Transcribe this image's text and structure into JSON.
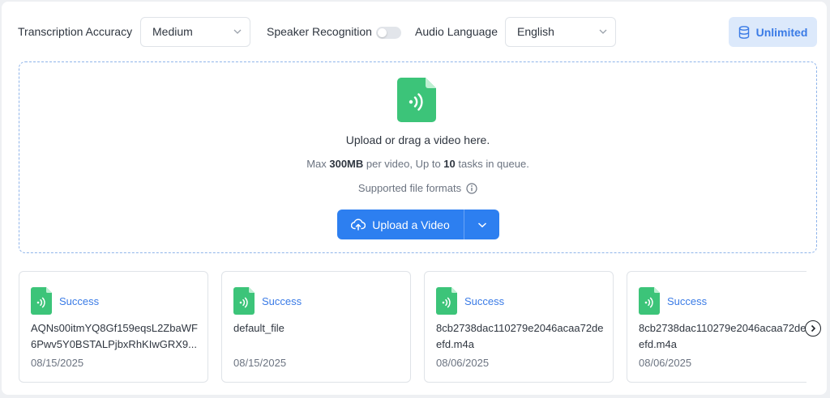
{
  "settings": {
    "accuracy_label": "Transcription Accuracy",
    "accuracy_value": "Medium",
    "speaker_label": "Speaker Recognition",
    "speaker_enabled": false,
    "language_label": "Audio Language",
    "language_value": "English",
    "plan_label": "Unlimited"
  },
  "upload": {
    "title": "Upload or drag a video here.",
    "limit_prefix": "Max ",
    "limit_size": "300MB",
    "limit_mid": " per video, Up to ",
    "limit_count": "10",
    "limit_suffix": " tasks in queue.",
    "formats_label": "Supported file formats",
    "button_label": "Upload a Video"
  },
  "files": [
    {
      "status": "Success",
      "name": "AQNs00itmYQ8Gf159eqsL2ZbaWF6Pwv5Y0BSTALPjbxRhKIwGRX9...",
      "date": "08/15/2025"
    },
    {
      "status": "Success",
      "name": "default_file",
      "date": "08/15/2025"
    },
    {
      "status": "Success",
      "name": "8cb2738dac110279e2046acaa72deefd.m4a",
      "date": "08/06/2025"
    },
    {
      "status": "Success",
      "name": "8cb2738dac110279e2046acaa72deefd.m4a",
      "date": "08/06/2025"
    }
  ],
  "colors": {
    "accent": "#2d7ff0",
    "success_green": "#3cc479",
    "status_text": "#3a7be6"
  },
  "icons": [
    "chevron-down-icon",
    "database-icon",
    "audio-file-icon",
    "info-icon",
    "cloud-upload-icon",
    "chevron-right-icon"
  ]
}
